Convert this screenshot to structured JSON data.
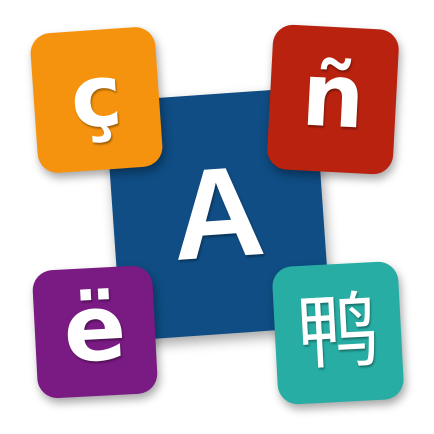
{
  "tiles": {
    "center": {
      "glyph": "A",
      "color": "#0f4d84"
    },
    "top_left": {
      "glyph": "ç",
      "color": "#f5930e"
    },
    "top_right": {
      "glyph": "ñ",
      "color": "#b8220f"
    },
    "bottom_left": {
      "glyph": "ë",
      "color": "#7a1a83"
    },
    "bottom_right": {
      "glyph": "鸭",
      "color": "#27ada3"
    }
  }
}
